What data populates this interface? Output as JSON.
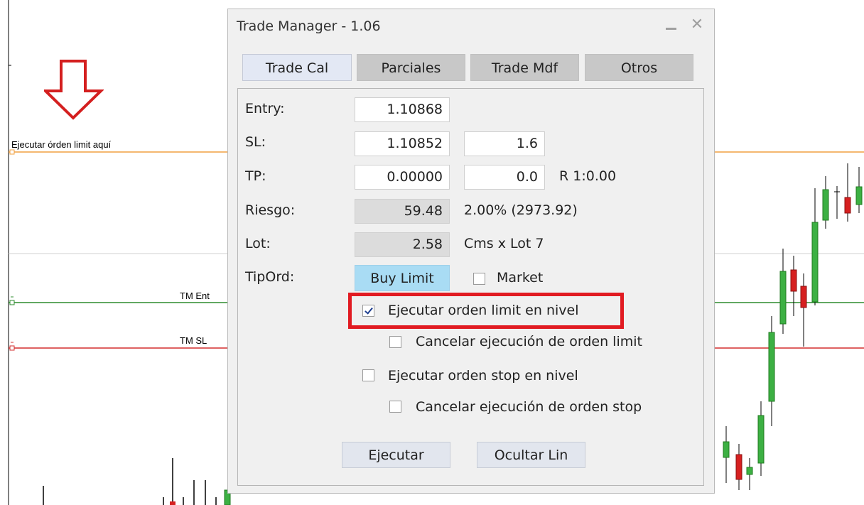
{
  "chart": {
    "annotation_text": "Ejecutar órden limit aquí",
    "tm_ent_label": "TM Ent",
    "tm_sl_label": "TM SL",
    "colors": {
      "entry_line": "#f0a040",
      "tm_ent": "#2e8b2e",
      "tm_sl": "#d32f2f",
      "bull_candle": "#3cb043",
      "bear_candle": "#d62020",
      "arrow": "#d41f1f"
    }
  },
  "window": {
    "title": "Trade Manager - 1.06",
    "minimize_icon": "minimize-icon",
    "close_icon": "close-icon"
  },
  "tabs": [
    {
      "label": "Trade Cal",
      "active": true
    },
    {
      "label": "Parciales",
      "active": false
    },
    {
      "label": "Trade Mdf",
      "active": false
    },
    {
      "label": "Otros",
      "active": false
    }
  ],
  "form": {
    "entry_label": "Entry:",
    "entry_value": "1.10868",
    "sl_label": "SL:",
    "sl_value": "1.10852",
    "sl_pips": "1.6",
    "tp_label": "TP:",
    "tp_value": "0.00000",
    "tp_pips": "0.0",
    "tp_ratio": "R 1:0.00",
    "risk_label": "Riesgo:",
    "risk_value": "59.48",
    "risk_pct": "2.00% (2973.92)",
    "lot_label": "Lot:",
    "lot_value": "2.58",
    "lot_note": "Cms x Lot 7",
    "tipord_label": "TipOrd:",
    "order_type": "Buy Limit",
    "market_label": "Market",
    "market_checked": false,
    "exec_limit_label": "Ejecutar orden limit en nivel",
    "exec_limit_checked": true,
    "cancel_limit_label": "Cancelar ejecución de orden limit",
    "cancel_limit_checked": false,
    "exec_stop_label": "Ejecutar orden stop en nivel",
    "exec_stop_checked": false,
    "cancel_stop_label": "Cancelar ejecución de orden stop",
    "cancel_stop_checked": false
  },
  "actions": {
    "execute_label": "Ejecutar",
    "hide_lines_label": "Ocultar Lin"
  }
}
